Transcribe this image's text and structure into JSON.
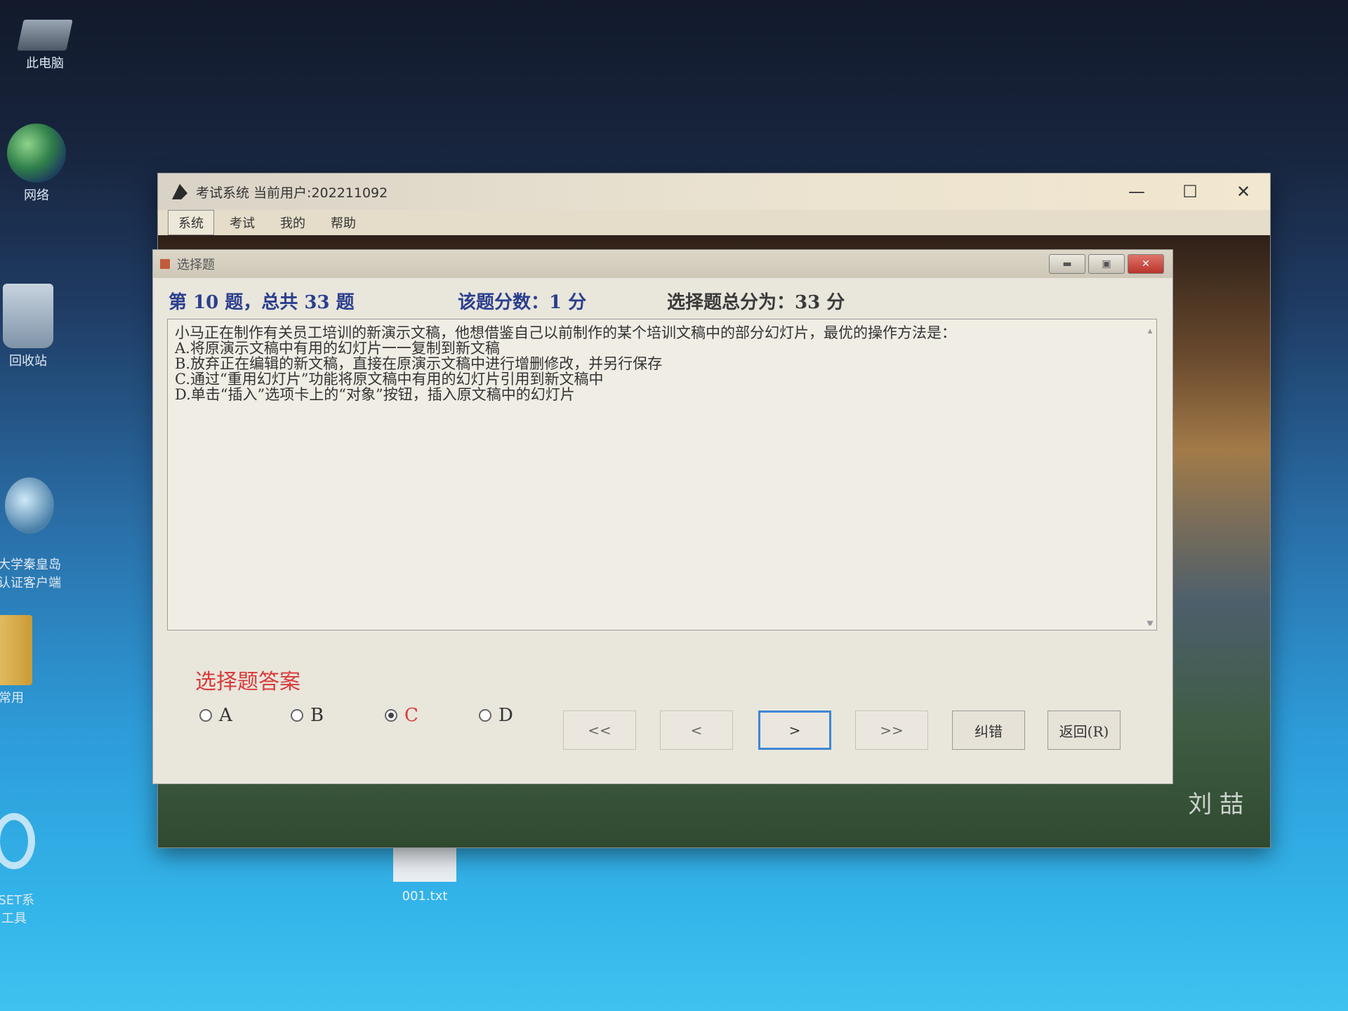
{
  "desktop": {
    "icons": [
      {
        "label": "此电脑"
      },
      {
        "label": "网络"
      },
      {
        "label": "回收站"
      },
      {
        "label": "大学秦皇岛\n认证客户端"
      },
      {
        "label": "常用"
      },
      {
        "label": "-SET系\n工具"
      }
    ],
    "file": {
      "label": "001.txt"
    }
  },
  "window": {
    "title": "考试系统 当前用户:202211092",
    "controls": {
      "minimize": "—",
      "maximize": "☐",
      "close": "✕"
    },
    "menu": [
      "系统",
      "考试",
      "我的",
      "帮助"
    ],
    "watermark": "刘 喆"
  },
  "dialog": {
    "title": "选择题",
    "controls": {
      "minimize": "▬",
      "restore": "▣",
      "close": "✕"
    },
    "info": {
      "question_position": "第  10 题，总共 33 题",
      "question_score": "该题分数：1 分",
      "total_score": "选择题总分为：33 分"
    },
    "question": {
      "stem": "小马正在制作有关员工培训的新演示文稿，他想借鉴自己以前制作的某个培训文稿中的部分幻灯片，最优的操作方法是：",
      "options": [
        "A.将原演示文稿中有用的幻灯片一一复制到新文稿",
        "B.放弃正在编辑的新文稿，直接在原演示文稿中进行增删修改，并另行保存",
        "C.通过“重用幻灯片”功能将原文稿中有用的幻灯片引用到新文稿中",
        "D.单击“插入”选项卡上的“对象”按钮，插入原文稿中的幻灯片"
      ]
    },
    "answer": {
      "title": "选择题答案",
      "choices": [
        "A",
        "B",
        "C",
        "D"
      ],
      "selected": "C"
    },
    "nav": {
      "first": "<<",
      "prev": "<",
      "next": ">",
      "last": ">>",
      "report": "纠错",
      "back": "返回(R)"
    }
  }
}
